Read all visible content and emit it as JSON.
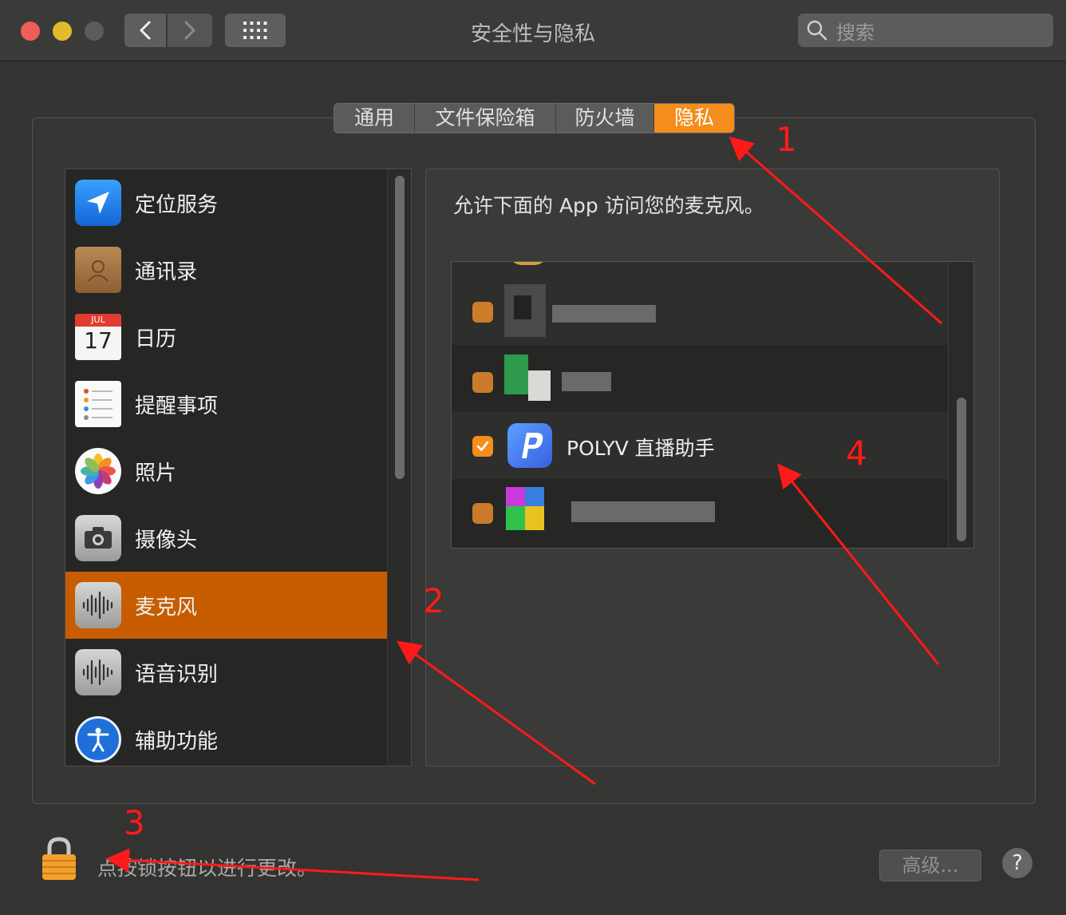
{
  "window": {
    "title": "安全性与隐私",
    "search_placeholder": "搜索"
  },
  "tabs": [
    {
      "label": "通用",
      "selected": false
    },
    {
      "label": "文件保险箱",
      "selected": false
    },
    {
      "label": "防火墙",
      "selected": false
    },
    {
      "label": "隐私",
      "selected": true
    }
  ],
  "sidebar": {
    "items": [
      {
        "label": "定位服务",
        "icon": "location-arrow-icon"
      },
      {
        "label": "通讯录",
        "icon": "contacts-book-icon"
      },
      {
        "label": "日历",
        "icon": "calendar-icon",
        "month": "JUL",
        "day": "17"
      },
      {
        "label": "提醒事项",
        "icon": "reminders-icon"
      },
      {
        "label": "照片",
        "icon": "photos-icon"
      },
      {
        "label": "摄像头",
        "icon": "camera-icon"
      },
      {
        "label": "麦克风",
        "icon": "microphone-wave-icon",
        "selected": true
      },
      {
        "label": "语音识别",
        "icon": "speech-wave-icon"
      },
      {
        "label": "辅助功能",
        "icon": "accessibility-icon"
      }
    ]
  },
  "main": {
    "description": "允许下面的 App 访问您的麦克风。",
    "apps": [
      {
        "name": "POLYV 直播助手",
        "checked": true,
        "icon": "polyv-p-icon"
      }
    ]
  },
  "footer": {
    "lock_hint": "点按锁按钮以进行更改。",
    "advanced_label": "高级...",
    "help_label": "?"
  },
  "annotations": {
    "markers": [
      "1",
      "2",
      "3",
      "4"
    ],
    "color": "#ff1a1a"
  },
  "colors": {
    "accent": "#f38d1b",
    "selection": "#c75c00"
  }
}
